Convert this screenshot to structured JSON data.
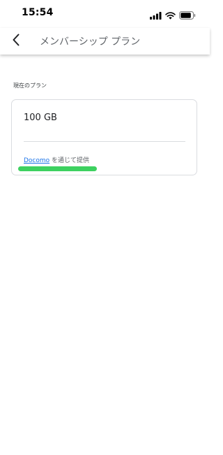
{
  "status_bar": {
    "time": "15:54",
    "icons": [
      "signal-icon",
      "wifi-icon",
      "battery-icon"
    ]
  },
  "app_bar": {
    "title": "メンバーシップ プラン",
    "back_icon": "chevron-left-icon"
  },
  "current_plan": {
    "section_label": "現在のプラン",
    "plan_name": "100 GB",
    "provider_link": "Docomo",
    "provider_suffix": "を通じて提供"
  },
  "colors": {
    "link": "#1a73e8",
    "highlight": "#3dd160",
    "card_border": "#dadce0"
  }
}
